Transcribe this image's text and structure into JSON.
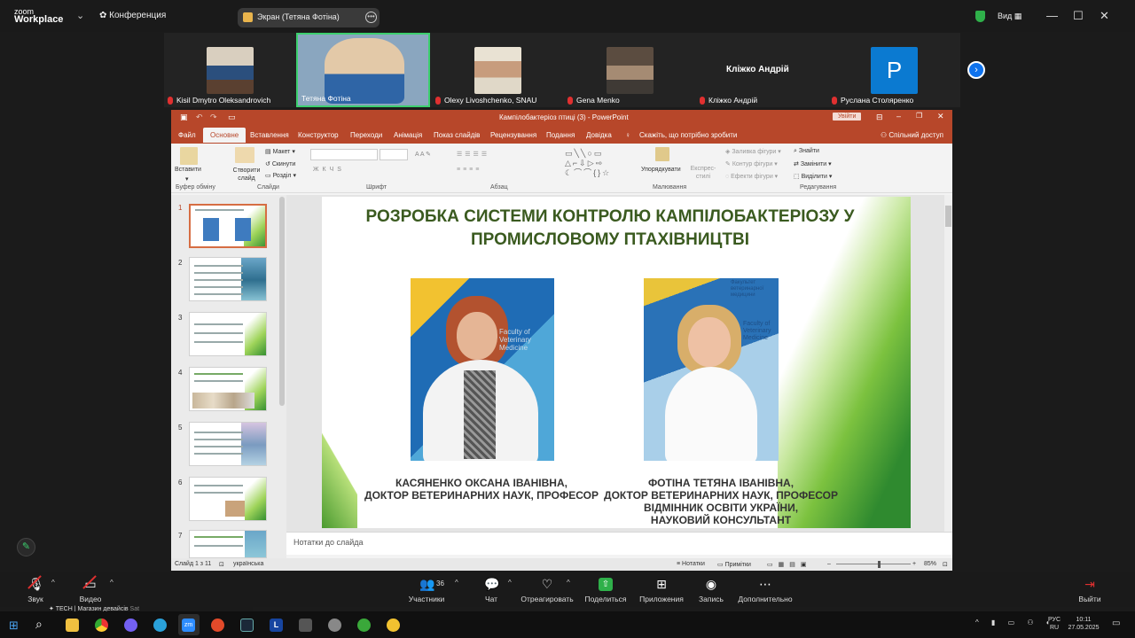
{
  "zoom": {
    "logo_line1": "zoom",
    "logo_line2": "Workplace",
    "conference": "Конференция",
    "share_pill": "Экран (Тетяна Фотіна)",
    "view": "Вид",
    "colors": {
      "share_border": "#3ccf6e",
      "shield": "#2fb04a",
      "mic_off": "#e03030",
      "ppt": "#b7472a",
      "title_green": "#3a5a1f"
    }
  },
  "gallery": [
    {
      "name": "Kisil Dmytro Oleksandrovich",
      "muted": true,
      "face": "video"
    },
    {
      "name": "Тетяна Фотіна",
      "muted": false,
      "active": true,
      "face": "video"
    },
    {
      "name": "Olexy Livoshchenko, SNAU",
      "muted": true,
      "face": "video"
    },
    {
      "name": "Gena Menko",
      "muted": true,
      "face": "video"
    },
    {
      "name": "Кліжко Андрій",
      "muted": true,
      "center_name": "Кліжко Андрій"
    },
    {
      "name": "Руслана Столяренко",
      "muted": true,
      "avatar_letter": "Р"
    }
  ],
  "ppt": {
    "window_title": "Кампілобактеріоз птиці (3)  -  PowerPoint",
    "sign_in": "Увійти",
    "menu": [
      "Файл",
      "Основне",
      "Вставлення",
      "Конструктор",
      "Переходи",
      "Анімація",
      "Показ слайдів",
      "Рецензування",
      "Подання",
      "Довідка"
    ],
    "tell_me": "Скажіть, що потрібно зробити",
    "share": "Спільний доступ",
    "ribbon": {
      "paste": "Вставити",
      "clipboard": "Буфер обміну",
      "new_slide": "Створити слайд",
      "layout": "Макет",
      "reset": "Скинути",
      "section": "Розділ",
      "slides_group": "Слайди",
      "font_group": "Шрифт",
      "paragraph_group": "Абзац",
      "arrange": "Упорядкувати",
      "quick_styles": "Експрес-стилі",
      "shape_fill": "Заливка фігури",
      "shape_outline": "Контур фігури",
      "shape_effects": "Ефекти фігури",
      "drawing_group": "Малювання",
      "find": "Знайти",
      "replace": "Замінити",
      "select": "Виділити",
      "editing_group": "Редагування"
    },
    "thumbs": [
      "1",
      "2",
      "3",
      "4",
      "5",
      "6",
      "7"
    ],
    "slide": {
      "title_line1": "РОЗРОБКА СИСТЕМИ КОНТРОЛЮ КАМПІЛОБАКТЕРІОЗУ У",
      "title_line2": "ПРОМИСЛОВОМУ ПТАХІВНИЦТВІ",
      "person1_l1": "КАСЯНЕНКО ОКСАНА ІВАНІВНА,",
      "person1_l2": "ДОКТОР ВЕТЕРИНАРНИХ НАУК, ПРОФЕСОР",
      "person2_l1": "ФОТІНА ТЕТЯНА ІВАНІВНА,",
      "person2_l2": "ДОКТОР ВЕТЕРИНАРНИХ НАУК, ПРОФЕСОР",
      "person2_l3": "ВІДМІННИК ОСВІТИ УКРАЇНИ,",
      "person2_l4": "НАУКОВИЙ КОНСУЛЬТАНТ",
      "banner_text": "Faculty of Veterinary Medicine",
      "banner_text2": "Факультет ветеринарної медицини"
    },
    "notes": "Нотатки до слайда",
    "status": {
      "slide": "Слайд 1 з 11",
      "lang": "українська",
      "notes": "Нотатки",
      "comments": "Примітки",
      "zoom": "85%"
    }
  },
  "toolbar": [
    {
      "label": "Звук",
      "icon": "mic-off"
    },
    {
      "label": "Видео",
      "icon": "video-off"
    },
    {
      "label": "Участники",
      "icon": "participants",
      "count": "36"
    },
    {
      "label": "Чат",
      "icon": "chat"
    },
    {
      "label": "Отреагировать",
      "icon": "react"
    },
    {
      "label": "Поделиться",
      "icon": "share"
    },
    {
      "label": "Приложения",
      "icon": "apps"
    },
    {
      "label": "Запись",
      "icon": "record"
    },
    {
      "label": "Дополнительно",
      "icon": "more"
    },
    {
      "label": "Выйти",
      "icon": "leave"
    }
  ],
  "taskbar": {
    "news": "TECH | Магазин девайсів",
    "news_small": "Sat",
    "lang1": "РУС",
    "lang2": "RU",
    "time": "10:11",
    "date": "27.05.2025"
  }
}
